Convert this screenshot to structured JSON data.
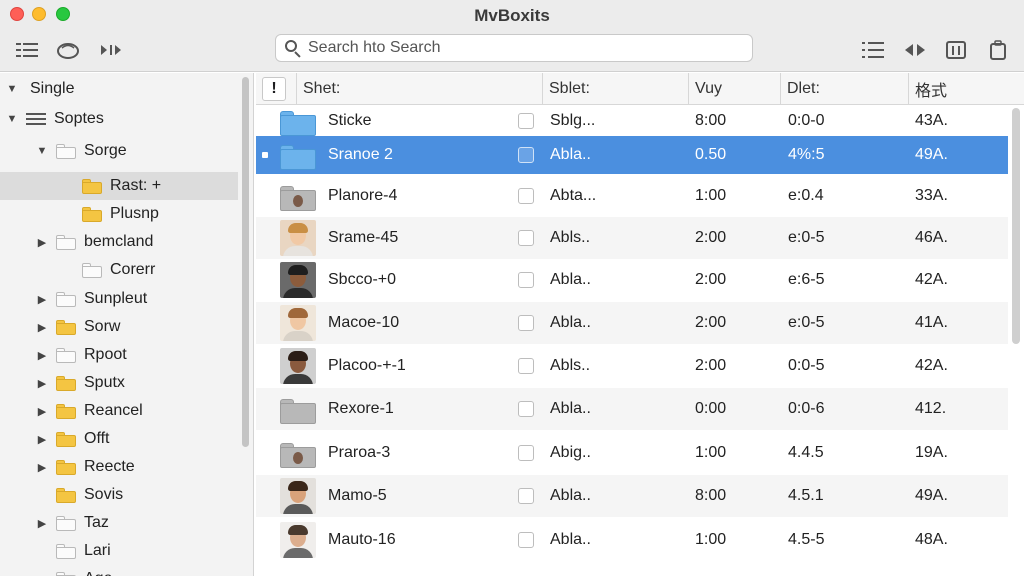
{
  "window": {
    "title": "MvBoxits"
  },
  "toolbar": {
    "search_placeholder": "Search hto Search"
  },
  "sidebar": {
    "header": "Single",
    "items": [
      {
        "label": "Soptes",
        "arrow": "▼",
        "icon": "list-icon",
        "indent": 0
      },
      {
        "label": "Sorge",
        "arrow": "▼",
        "icon": "folder-white",
        "indent": 1
      },
      {
        "label": "Rast: +",
        "arrow": "",
        "icon": "folder-yellow",
        "indent": 2,
        "selected": true
      },
      {
        "label": "Plusnp",
        "arrow": "",
        "icon": "folder-yellow",
        "indent": 2
      },
      {
        "label": "bemcland",
        "arrow": "▶",
        "icon": "folder-white",
        "indent": 1
      },
      {
        "label": "Corerr",
        "arrow": "",
        "icon": "folder-white",
        "indent": 2
      },
      {
        "label": "Sunpleut",
        "arrow": "▶",
        "icon": "folder-white",
        "indent": 1
      },
      {
        "label": "Sorw",
        "arrow": "▶",
        "icon": "folder-yellow",
        "indent": 1
      },
      {
        "label": "Rpoot",
        "arrow": "▶",
        "icon": "folder-white",
        "indent": 1
      },
      {
        "label": "Sputx",
        "arrow": "▶",
        "icon": "folder-yellow",
        "indent": 1
      },
      {
        "label": "Reancel",
        "arrow": "▶",
        "icon": "folder-yellow",
        "indent": 1
      },
      {
        "label": "Offt",
        "arrow": "▶",
        "icon": "folder-yellow",
        "indent": 1
      },
      {
        "label": "Reecte",
        "arrow": "▶",
        "icon": "folder-yellow",
        "indent": 1
      },
      {
        "label": "Sovis",
        "arrow": "",
        "icon": "folder-yellow",
        "indent": 1
      },
      {
        "label": "Taz",
        "arrow": "▶",
        "icon": "folder-white",
        "indent": 1
      },
      {
        "label": "Lari",
        "arrow": "",
        "icon": "folder-white",
        "indent": 1
      },
      {
        "label": "Age",
        "arrow": "",
        "icon": "folder-white",
        "indent": 1
      }
    ]
  },
  "table": {
    "headers": [
      "!",
      "Shet:",
      "Sblet:",
      "Vuy",
      "Dlet:",
      "格式"
    ],
    "rows": [
      {
        "thumb": "folder-blue",
        "name": "Sticke",
        "col2": "Sblg...",
        "col3": "8:00",
        "col4": "0:0-0",
        "col5": "43A."
      },
      {
        "thumb": "folder-blue",
        "name": "Sranoe 2",
        "col2": "Abla..",
        "col3": "0.50",
        "col4": "4%:5",
        "col5": "49A.",
        "selected": true
      },
      {
        "thumb": "folder-gray-face",
        "name": "Planore-4",
        "col2": "Abta...",
        "col3": "1:00",
        "col4": "e:0.4",
        "col5": "33A."
      },
      {
        "thumb": "face-woman-blonde",
        "name": "Srame-45",
        "col2": "Abls..",
        "col3": "2:00",
        "col4": "e:0-5",
        "col5": "46A."
      },
      {
        "thumb": "face-man-dark",
        "name": "Sbcco-+0",
        "col2": "Abla..",
        "col3": "2:00",
        "col4": "e:6-5",
        "col5": "42A."
      },
      {
        "thumb": "face-woman-brown",
        "name": "Macoe-10",
        "col2": "Abla..",
        "col3": "2:00",
        "col4": "e:0-5",
        "col5": "41A."
      },
      {
        "thumb": "face-man-beard",
        "name": "Placoo-+-1",
        "col2": "Abls..",
        "col3": "2:00",
        "col4": "0:0-5",
        "col5": "42A."
      },
      {
        "thumb": "folder-gray",
        "name": "Rexore-1",
        "col2": "Abla..",
        "col3": "0:00",
        "col4": "0:0-6",
        "col5": "412."
      },
      {
        "thumb": "folder-gray-face",
        "name": "Praroa-3",
        "col2": "Abig..",
        "col3": "1:00",
        "col4": "4.4.5",
        "col5": "19A."
      },
      {
        "thumb": "face-man-young",
        "name": "Mamo-5",
        "col2": "Abla..",
        "col3": "8:00",
        "col4": "4.5.1",
        "col5": "49A."
      },
      {
        "thumb": "face-man-glasses",
        "name": "Mauto-16",
        "col2": "Abla..",
        "col3": "1:00",
        "col4": "4.5-5",
        "col5": "48A."
      }
    ]
  },
  "colors": {
    "selection": "#4b8fdf",
    "folder_yellow": "#f4c542",
    "folder_blue": "#6cb3ec"
  }
}
